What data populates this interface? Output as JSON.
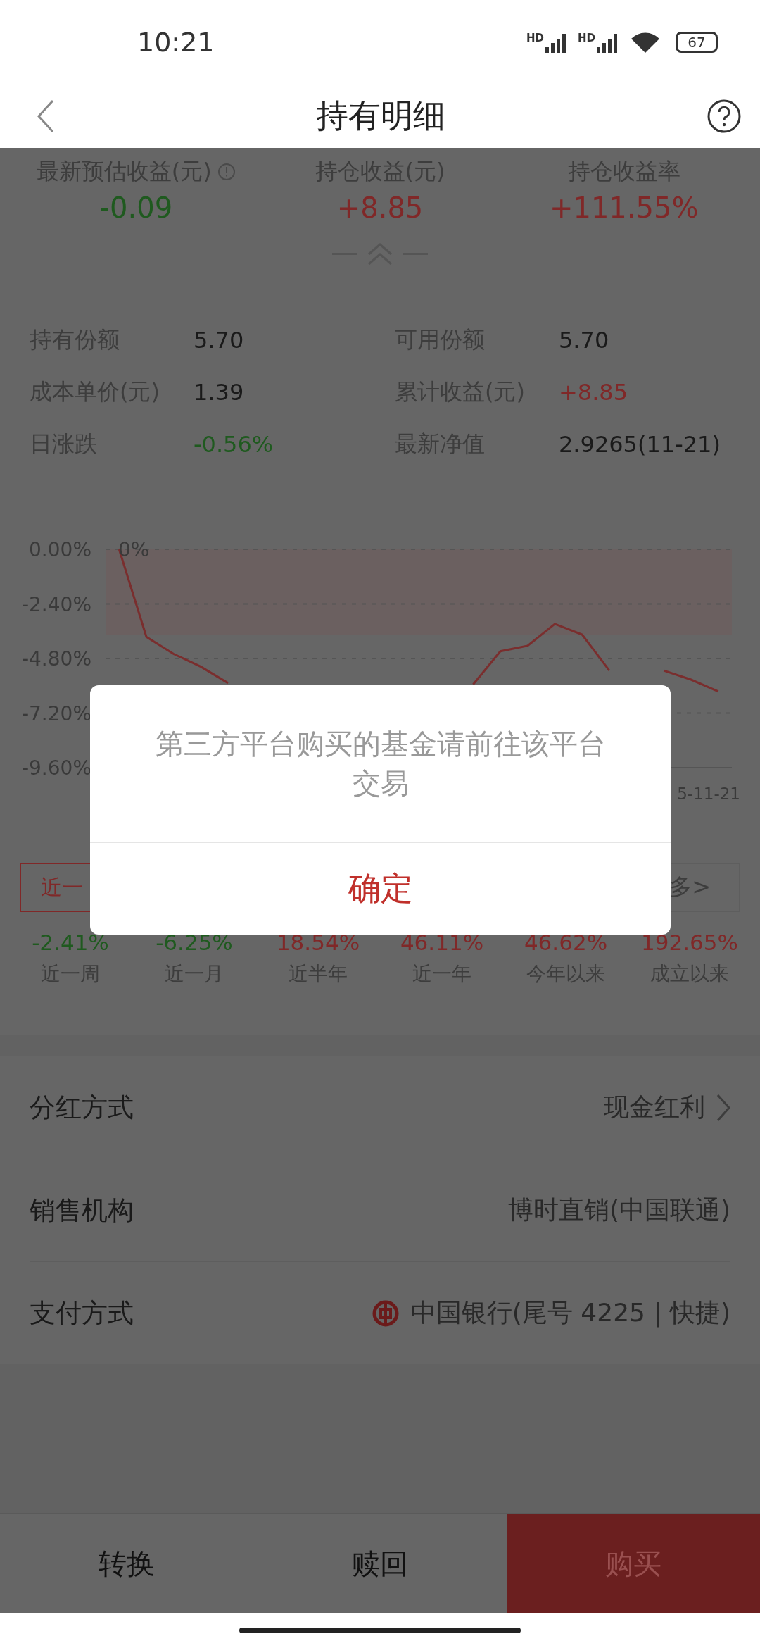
{
  "status_bar": {
    "time": "10:21",
    "network_labels": [
      "HD",
      "HD"
    ],
    "battery": "67"
  },
  "nav": {
    "title": "持有明细"
  },
  "summary": [
    {
      "label": "最新预估收益(元)",
      "value": "-0.09",
      "color": "#1f5a1f",
      "info": true
    },
    {
      "label": "持仓收益(元)",
      "value": "+8.85",
      "color": "#802828",
      "info": false
    },
    {
      "label": "持仓收益率",
      "value": "+111.55%",
      "color": "#802828",
      "info": false
    }
  ],
  "details": [
    {
      "label": "持有份额",
      "value": "5.70",
      "color": "#1a1a1a"
    },
    {
      "label": "可用份额",
      "value": "5.70",
      "color": "#1a1a1a"
    },
    {
      "label": "成本单价(元)",
      "value": "1.39",
      "color": "#1a1a1a"
    },
    {
      "label": "累计收益(元)",
      "value": "+8.85",
      "color": "#802828"
    },
    {
      "label": "日涨跌",
      "value": "-0.56%",
      "color": "#1f5a1f"
    },
    {
      "label": "最新净值",
      "value": "2.9265(11-21)",
      "color": "#1a1a1a"
    }
  ],
  "chart": {
    "start_label": "0%",
    "end_date": "5-11-21",
    "chart_data": {
      "type": "line",
      "series": [
        {
          "color": "#7a2e2e",
          "values": [
            0,
            -3.85,
            -4.6,
            -5.16,
            -5.88,
            null,
            null,
            null,
            null,
            null,
            null,
            null,
            null,
            -5.94,
            -4.48,
            -4.24,
            -3.28,
            -3.75,
            -5.33,
            null,
            -5.33,
            -5.73,
            -6.25
          ]
        }
      ],
      "ylim": [
        -9.6,
        0
      ],
      "grid": true,
      "yticks": [
        {
          "value": 0,
          "label": "0.00%"
        },
        {
          "value": -2.4,
          "label": "-2.40%"
        },
        {
          "value": -4.8,
          "label": "-4.80%"
        },
        {
          "value": -7.2,
          "label": "-7.20%"
        },
        {
          "value": -9.6,
          "label": "-9.60%"
        }
      ]
    }
  },
  "period_tabs": [
    {
      "label": "近一",
      "selected": true
    },
    {
      "label": "多>",
      "selected": false
    }
  ],
  "returns": [
    {
      "value": "-2.41%",
      "label": "近一周",
      "color": "#1f5a1f"
    },
    {
      "value": "-6.25%",
      "label": "近一月",
      "color": "#1f5a1f"
    },
    {
      "value": "18.54%",
      "label": "近半年",
      "color": "#802828"
    },
    {
      "value": "46.11%",
      "label": "近一年",
      "color": "#802828"
    },
    {
      "value": "46.62%",
      "label": "今年以来",
      "color": "#802828"
    },
    {
      "value": "192.65%",
      "label": "成立以来",
      "color": "#802828"
    }
  ],
  "settings": [
    {
      "label": "分红方式",
      "value": "现金红利",
      "kind": "link"
    },
    {
      "label": "销售机构",
      "value": "博时直销(中国联通)",
      "kind": "text"
    },
    {
      "label": "支付方式",
      "value": "中国银行(尾号 4225 | 快捷)",
      "kind": "bank"
    }
  ],
  "actions": [
    {
      "label": "转换",
      "kind": "plain"
    },
    {
      "label": "赎回",
      "kind": "plain"
    },
    {
      "label": "购买",
      "kind": "primary"
    }
  ],
  "dialog": {
    "message": "第三方平台购买的基金请前往该平台交易",
    "confirm": "确定"
  }
}
